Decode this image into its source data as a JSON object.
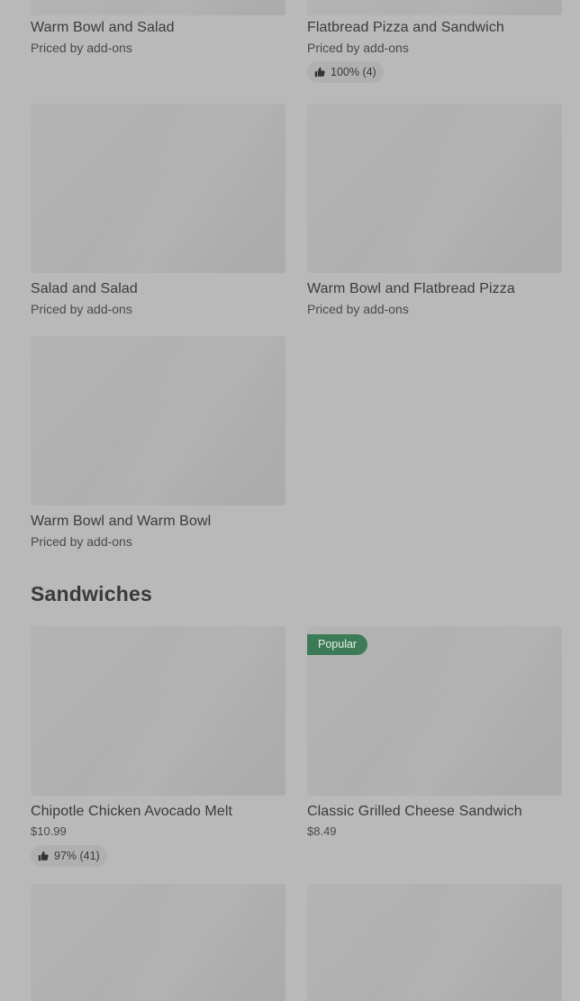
{
  "cards": [
    {
      "title": "Warm Bowl and Salad",
      "sub": "Priced by add-ons"
    },
    {
      "title": "Flatbread Pizza and Sandwich",
      "sub": "Priced by add-ons",
      "rating": "100% (4)"
    },
    {
      "title": "Salad and Salad",
      "sub": "Priced by add-ons"
    },
    {
      "title": "Warm Bowl and Flatbread Pizza",
      "sub": "Priced by add-ons"
    },
    {
      "title": "Warm Bowl and Warm Bowl",
      "sub": "Priced by add-ons"
    }
  ],
  "sandwiches": {
    "heading": "Sandwiches",
    "items": [
      {
        "title": "Chipotle Chicken Avocado Melt",
        "price": "$10.99",
        "rating": "97% (41)"
      },
      {
        "title": "Classic Grilled Cheese Sandwich",
        "price": "$8.49",
        "badge": "Popular"
      }
    ]
  },
  "icons": {
    "rating_icon": "thumbs-up-icon"
  },
  "colors": {
    "background": "#b9b9b9",
    "badge": "#3d7b58",
    "pill": "#b0b0b0"
  }
}
